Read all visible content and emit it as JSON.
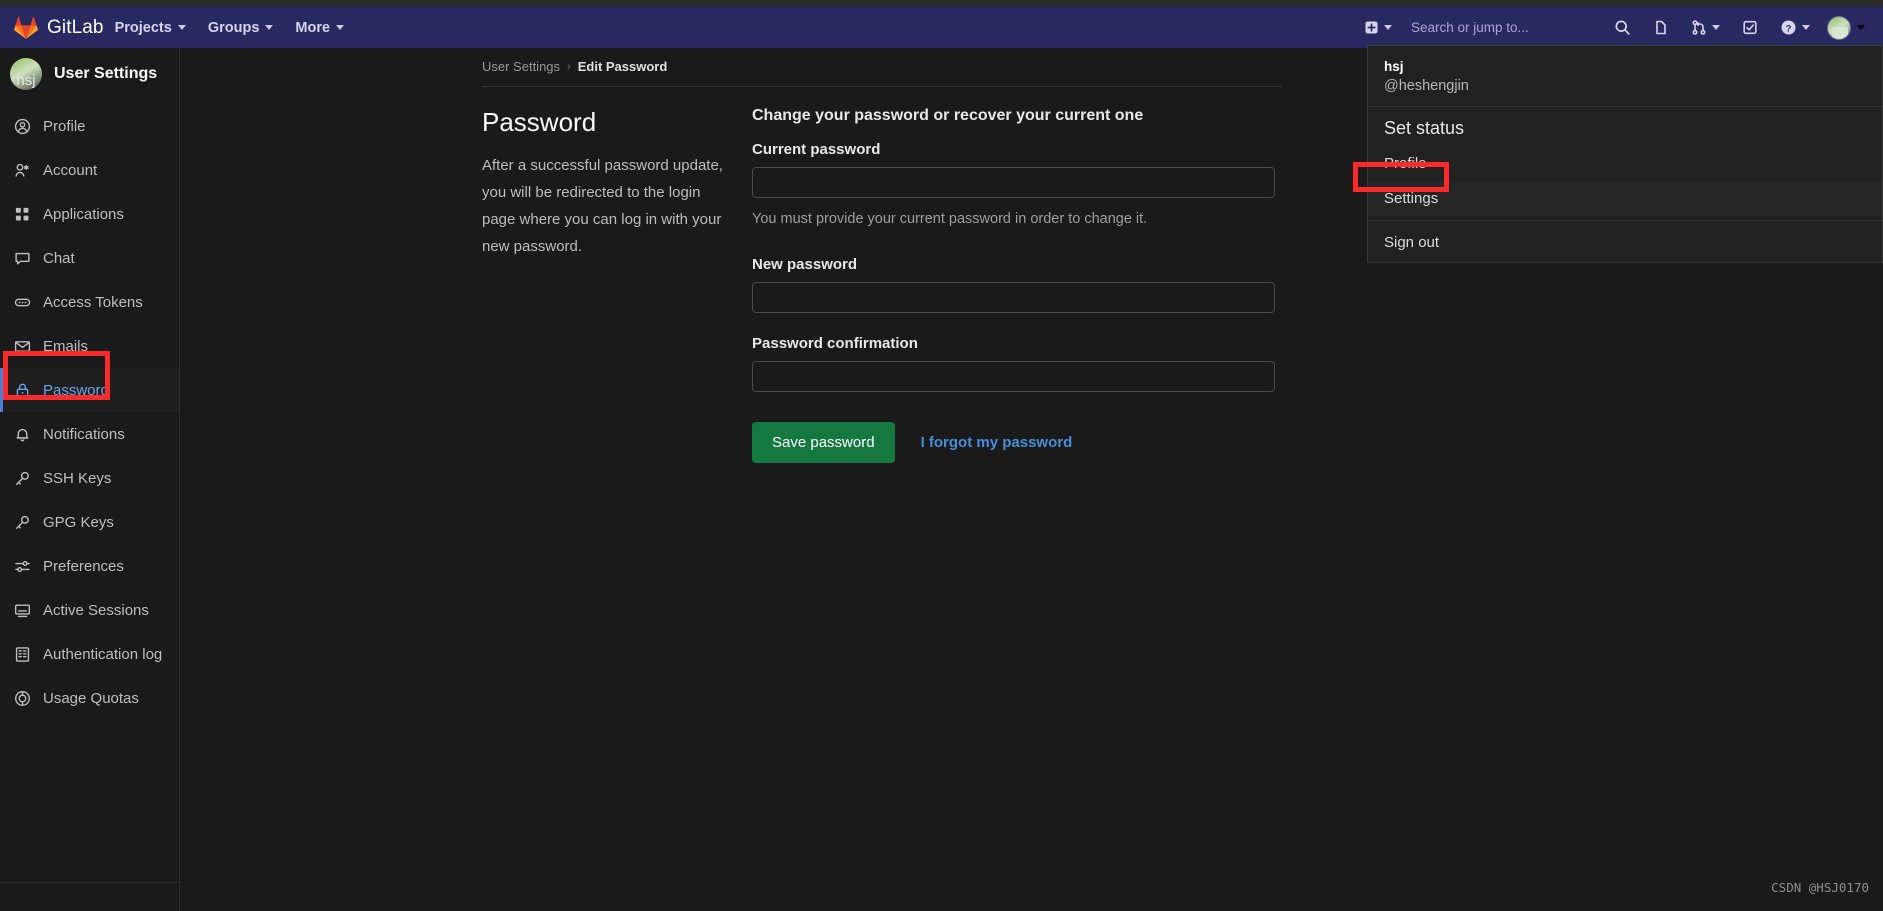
{
  "navbar": {
    "brand": "GitLab",
    "logo_icon": "gitlab-tanuki-logo",
    "items": [
      {
        "label": "Projects",
        "icon": "chevron-down-icon"
      },
      {
        "label": "Groups",
        "icon": "chevron-down-icon"
      },
      {
        "label": "More",
        "icon": "chevron-down-icon"
      }
    ],
    "new_dropdown": {
      "icon": "plus-square-icon",
      "caret": "chevron-down-icon"
    },
    "search_placeholder": "Search or jump to...",
    "right_icons": [
      {
        "name": "search-icon",
        "glyph": "search"
      },
      {
        "name": "issues-icon",
        "glyph": "issues"
      },
      {
        "name": "merge-requests-icon",
        "glyph": "merge",
        "caret": true
      },
      {
        "name": "todos-icon",
        "glyph": "todo"
      },
      {
        "name": "help-icon",
        "glyph": "help",
        "caret": true
      }
    ],
    "avatar": {
      "name": "user-avatar",
      "caret": "chevron-down-icon"
    }
  },
  "user_menu": {
    "name": "hsj",
    "handle": "@heshengjin",
    "set_status": "Set status",
    "profile": "Profile",
    "settings": "Settings",
    "sign_out": "Sign out"
  },
  "sidebar": {
    "title": "User Settings",
    "avatar_initials": "hsj",
    "items": [
      {
        "label": "Profile",
        "icon": "user-circle-icon",
        "active": false
      },
      {
        "label": "Account",
        "icon": "account-key-icon",
        "active": false
      },
      {
        "label": "Applications",
        "icon": "applications-icon",
        "active": false
      },
      {
        "label": "Chat",
        "icon": "chat-icon",
        "active": false
      },
      {
        "label": "Access Tokens",
        "icon": "token-icon",
        "active": false
      },
      {
        "label": "Emails",
        "icon": "envelope-icon",
        "active": false
      },
      {
        "label": "Password",
        "icon": "lock-icon",
        "active": true
      },
      {
        "label": "Notifications",
        "icon": "bell-icon",
        "active": false
      },
      {
        "label": "SSH Keys",
        "icon": "key-icon",
        "active": false
      },
      {
        "label": "GPG Keys",
        "icon": "key-icon",
        "active": false
      },
      {
        "label": "Preferences",
        "icon": "sliders-icon",
        "active": false
      },
      {
        "label": "Active Sessions",
        "icon": "monitor-icon",
        "active": false
      },
      {
        "label": "Authentication log",
        "icon": "log-list-icon",
        "active": false
      },
      {
        "label": "Usage Quotas",
        "icon": "quota-gauge-icon",
        "active": false
      }
    ]
  },
  "breadcrumb": {
    "root": "User Settings",
    "separator": "›",
    "current": "Edit Password"
  },
  "page": {
    "heading": "Password",
    "description": "After a successful password update, you will be redirected to the login page where you can log in with your new password.",
    "form_title": "Change your password or recover your current one",
    "fields": [
      {
        "label": "Current password",
        "value": "",
        "help": "You must provide your current password in order to change it."
      },
      {
        "label": "New password",
        "value": "",
        "help": ""
      },
      {
        "label": "Password confirmation",
        "value": "",
        "help": ""
      }
    ],
    "save_label": "Save password",
    "forgot_label": "I forgot my password"
  },
  "watermark": "CSDN @HSJ0170",
  "colors": {
    "navbar_bg": "#292961",
    "page_bg": "#1a1a1a",
    "accent_blue": "#428fdc",
    "active_blue": "#63a6f2",
    "save_green": "#14793f",
    "annotation_red": "#fb2b2b"
  }
}
